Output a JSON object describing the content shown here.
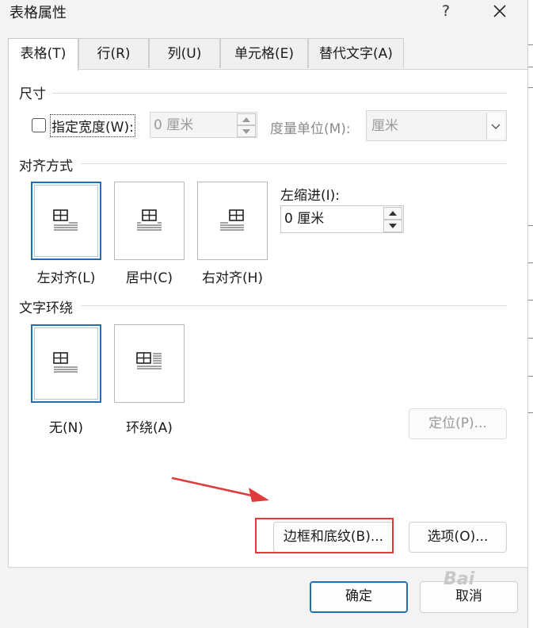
{
  "dialog": {
    "title": "表格属性",
    "help_label": "?"
  },
  "tabs": [
    {
      "label": "表格(T)",
      "active": true
    },
    {
      "label": "行(R)"
    },
    {
      "label": "列(U)"
    },
    {
      "label": "单元格(E)"
    },
    {
      "label": "替代文字(A)"
    }
  ],
  "size": {
    "section_title": "尺寸",
    "specify_width_label": "指定宽度(W):",
    "width_value": "0 厘米",
    "measure_label": "度量单位(M):",
    "measure_value": "厘米"
  },
  "alignment": {
    "section_title": "对齐方式",
    "options": [
      {
        "label": "左对齐(L)",
        "selected": true
      },
      {
        "label": "居中(C)"
      },
      {
        "label": "右对齐(H)"
      }
    ],
    "indent_label": "左缩进(I):",
    "indent_value": "0 厘米"
  },
  "text_wrapping": {
    "section_title": "文字环绕",
    "options": [
      {
        "label": "无(N)",
        "selected": true
      },
      {
        "label": "环绕(A)"
      }
    ],
    "positioning_label": "定位(P)..."
  },
  "buttons": {
    "borders_shading": "边框和底纹(B)...",
    "options": "选项(O)...",
    "ok": "确定",
    "cancel": "取消"
  },
  "watermark": "Bai",
  "colors": {
    "accent": "#1f6fb5",
    "annotation": "#e13a3a"
  }
}
